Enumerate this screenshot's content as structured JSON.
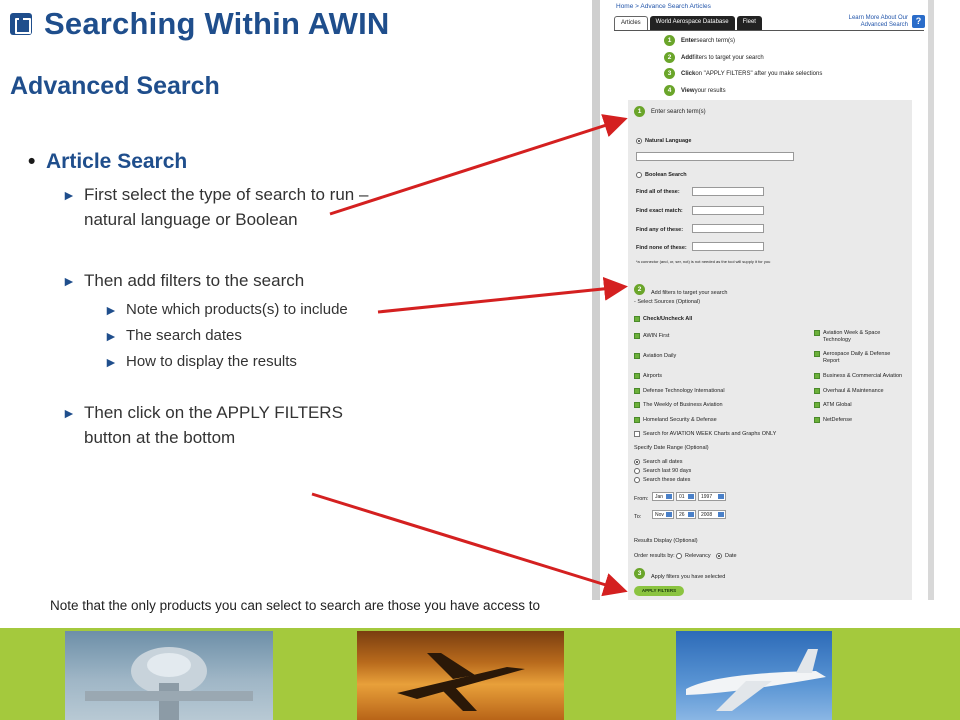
{
  "slide": {
    "title": "Searching Within AWIN",
    "subtitle": "Advanced Search",
    "bullet_main": "Article Search",
    "sub1": "First select the type of search to run – natural language or Boolean",
    "sub2": "Then add filters to the search",
    "sub2_items": [
      "Note which products(s) to include",
      "The search dates",
      "How to display the results"
    ],
    "sub3": "Then click on the APPLY FILTERS button at the bottom",
    "note": "Note that the only products you can select to search are those you have access to",
    "arrow_color": "#d42020",
    "title_color": "#1f4e8c"
  },
  "screenshot": {
    "breadcrumb": "Home > Advance Search Articles",
    "tabs": [
      "Articles",
      "World Aerospace Database",
      "Fleet"
    ],
    "learn_more": "Learn More About Our Advanced Search",
    "help": "?",
    "steps": [
      {
        "n": "1",
        "bold": "Enter",
        "rest": " search term(s)"
      },
      {
        "n": "2",
        "bold": "Add",
        "rest": " filters to target your search"
      },
      {
        "n": "3",
        "bold": "Click",
        "rest": " on \"APPLY FILTERS\" after you make selections"
      },
      {
        "n": "4",
        "bold": "View",
        "rest": " your results"
      }
    ],
    "form": {
      "enter": "Enter search term(s)",
      "natural": "Natural Language",
      "boolean": "Boolean Search",
      "find_all": "Find all of these:",
      "find_exact": "Find exact match:",
      "find_any": "Find any of these:",
      "find_none": "Find none of these:",
      "connector_note": "*a connector (and, or, ser, not) is not needed as the tool will supply it for you",
      "add_filters": "Add filters to target your search",
      "select_sources": "- Select Sources (Optional)",
      "check_all": "Check/Uncheck All",
      "sources_left": [
        "AWIN First",
        "Aviation Daily",
        "Airports",
        "Defense Technology International",
        "The Weekly of Business Aviation",
        "Homeland Security & Defense"
      ],
      "sources_right": [
        "Aviation Week & Space Technology",
        "Aerospace Daily & Defense Report",
        "Business & Commercial Aviation",
        "Overhaul & Maintenance",
        "ATM Global",
        "NetDefense"
      ],
      "charts": "Search for AVIATION WEEK Charts and Graphs ONLY",
      "date_range": "Specify Date Range (Optional)",
      "date_opts": [
        "Search all dates",
        "Search last 90 days",
        "Search these dates"
      ],
      "from_label": "From:",
      "to_label": "To:",
      "from": [
        "Jan",
        "01",
        "1997"
      ],
      "to": [
        "Nov",
        "26",
        "2008"
      ],
      "results_display": "Results Display (Optional)",
      "order_by": "Order results by:",
      "relevancy": "Relevancy",
      "date": "Date",
      "apply_sel": "Apply filters you have selected",
      "apply_btn": "APPLY FILTERS"
    }
  },
  "photos": [
    "fighter-jet-photo",
    "business-jet-photo",
    "airliner-photo"
  ]
}
